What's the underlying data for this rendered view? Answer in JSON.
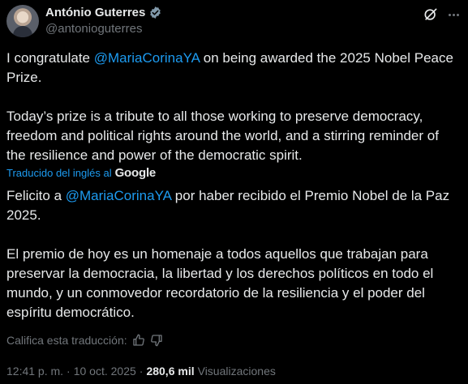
{
  "author": {
    "display_name": "António Guterres",
    "handle": "@antonioguterres"
  },
  "original": {
    "line1_prefix": "I congratulate ",
    "mention": "@MariaCorinaYA",
    "line1_suffix": " on being awarded the 2025 Nobel Peace Prize.",
    "paragraph2": "Today’s prize is a tribute to all those working to preserve democracy, freedom and political rights around the world, and a stirring reminder of the resilience and power of the democratic spirit."
  },
  "translation_notice": {
    "label": "Traducido del inglés al",
    "provider": "Google"
  },
  "translated": {
    "line1_prefix": "Felicito a ",
    "mention": "@MariaCorinaYA",
    "line1_suffix": " por haber recibido el Premio Nobel de la Paz 2025.",
    "paragraph2": "El premio de hoy es un homenaje a todos aquellos que trabajan para preservar la democracia, la libertad y los derechos políticos en todo el mundo, y un conmovedor recordatorio de la resiliencia y el poder del espíritu democrático."
  },
  "rate_translation": {
    "label": "Califica esta traducción:"
  },
  "meta": {
    "time": "12:41 p. m.",
    "sep1": "·",
    "date": "10 oct. 2025",
    "sep2": "·",
    "views_count": "280,6 mil",
    "views_label": "Visualizaciones"
  },
  "colors": {
    "background": "#000000",
    "text": "#e7e9ea",
    "secondary": "#71767b",
    "link": "#1d9bf0"
  }
}
